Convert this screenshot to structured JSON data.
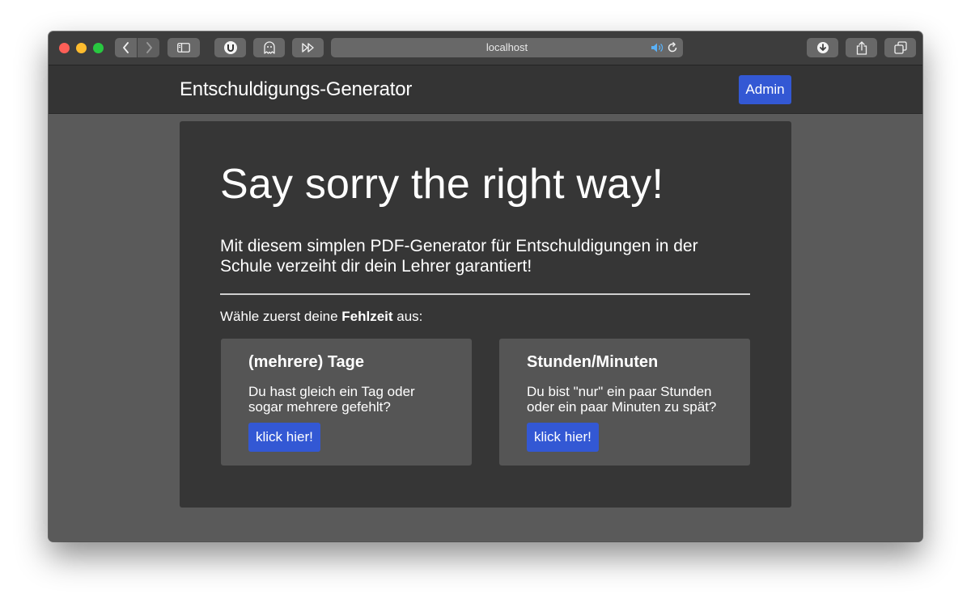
{
  "browser": {
    "url": "localhost",
    "accent_color": "#3358d4"
  },
  "navbar": {
    "brand": "Entschuldigungs-Generator",
    "admin_label": "Admin"
  },
  "hero": {
    "title": "Say sorry the right way!",
    "lead": "Mit diesem simplen PDF-Generator für Entschuldigungen in der Schule verzeiht dir dein Lehrer garantiert!",
    "prompt_prefix": "Wähle zuerst deine ",
    "prompt_bold": "Fehlzeit",
    "prompt_suffix": " aus:"
  },
  "cards": [
    {
      "title": "(mehrere) Tage",
      "text": "Du hast gleich ein Tag oder sogar mehrere gefehlt?",
      "button": "klick hier!"
    },
    {
      "title": "Stunden/Minuten",
      "text": "Du bist \"nur\" ein paar Stunden oder ein paar Minuten zu spät?",
      "button": "klick hier!"
    }
  ]
}
